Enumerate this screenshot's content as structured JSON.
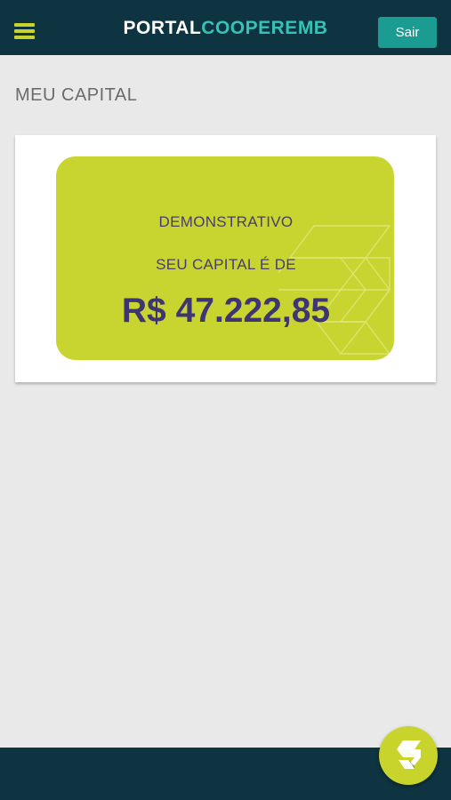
{
  "header": {
    "brand_part1": "PORTAL",
    "brand_part2": "COOPEREMB",
    "logout_label": "Sair",
    "menu_icon": "hamburger-menu-icon"
  },
  "page": {
    "title": "MEU CAPITAL"
  },
  "capital_card": {
    "heading": "DEMONSTRATIVO",
    "subtitle": "SEU CAPITAL É DE",
    "amount": "R$ 47.222,85"
  },
  "fab": {
    "icon": "cooperemb-logo-icon"
  },
  "colors": {
    "header_bg": "#0d3440",
    "accent_lime": "#c8d42f",
    "accent_teal": "#36c2b4",
    "button_teal": "#1b9c93",
    "text_purple": "#3f3572",
    "page_bg": "#e9e9e9"
  }
}
